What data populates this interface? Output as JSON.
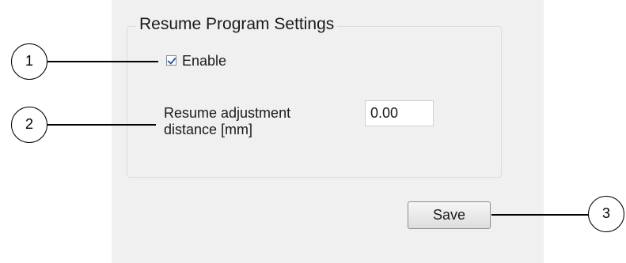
{
  "settings": {
    "group_title": "Resume Program Settings",
    "enable_label": "Enable",
    "enable_checked": true,
    "distance_label": "Resume adjustment distance [mm]",
    "distance_value": "0.00",
    "save_label": "Save"
  },
  "callouts": [
    {
      "number": "1"
    },
    {
      "number": "2"
    },
    {
      "number": "3"
    }
  ]
}
